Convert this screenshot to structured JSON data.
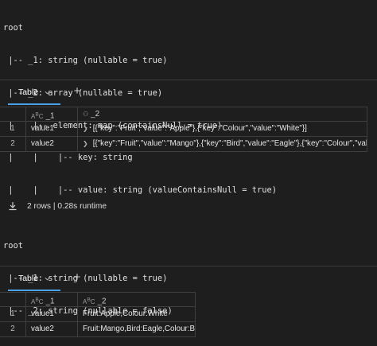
{
  "schema1": {
    "lines": [
      "root",
      " |-- _1: string (nullable = true)",
      " |-- _2: array (nullable = true)",
      " |    |-- element: map (containsNull = true)",
      " |    |    |-- key: string",
      " |    |    |-- value: string (valueContainsNull = true)"
    ]
  },
  "table1": {
    "tab_label": "Table",
    "add_label": "+",
    "headers": [
      "_1",
      "_2"
    ],
    "header_icons": [
      "abc-icon",
      "struct-icon"
    ],
    "rows": [
      {
        "idx": "1",
        "a": "value1",
        "b": "[{\"key\":\"Fruit\",\"value\":\"Apple\"},{\"key\":\"Colour\",\"value\":\"White\"}]"
      },
      {
        "idx": "2",
        "a": "value2",
        "b": "[{\"key\":\"Fruit\",\"value\":\"Mango\"},{\"key\":\"Bird\",\"value\":\"Eagle\"},{\"key\":\"Colour\",\"value\":\"Bl..."
      }
    ]
  },
  "status": {
    "rows_text": "2 rows",
    "separator": "|",
    "runtime_text": "0.28s runtime"
  },
  "schema2": {
    "lines": [
      "root",
      " |-- _1: string (nullable = true)",
      " |-- _2: string (nullable = false)"
    ]
  },
  "table2": {
    "tab_label": "Table",
    "add_label": "+",
    "headers": [
      "_1",
      "_2"
    ],
    "header_icons": [
      "abc-icon",
      "abc-icon"
    ],
    "rows": [
      {
        "idx": "1",
        "a": "value1",
        "b": "Fruit:Apple,Colour:White"
      },
      {
        "idx": "2",
        "a": "value2",
        "b": "Fruit:Mango,Bird:Eagle,Colour:Bla..."
      }
    ]
  },
  "colors": {
    "background": "#1e1e1e",
    "accent": "#4aa0e6",
    "grid_line": "#3e3e3e"
  }
}
